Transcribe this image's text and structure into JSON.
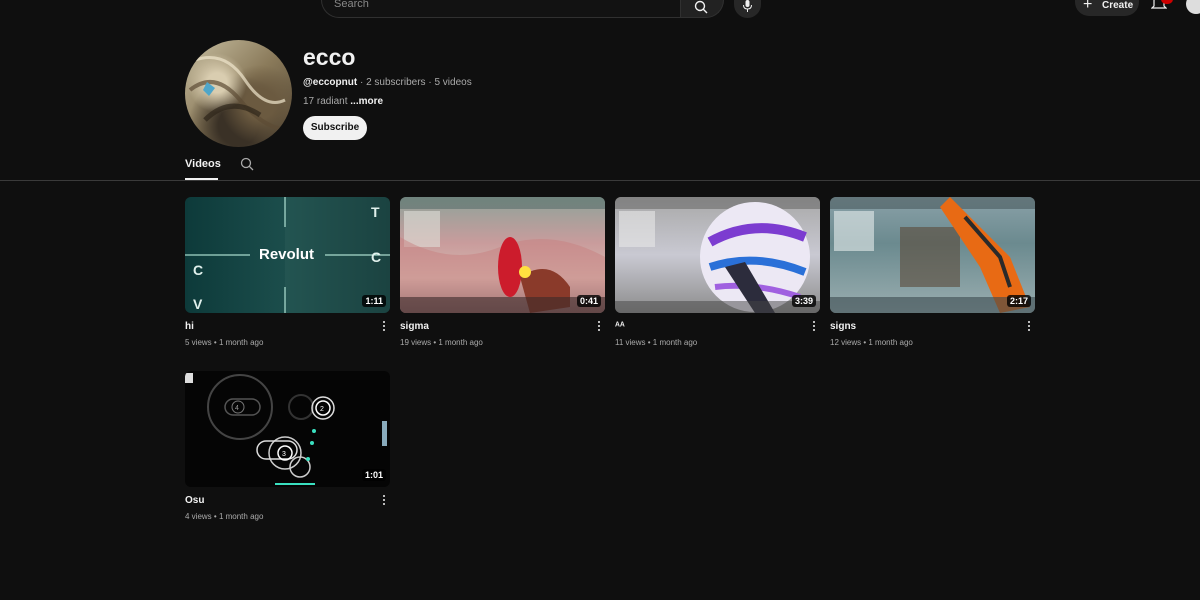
{
  "topbar": {
    "search_placeholder": "Search",
    "create_label": "Create"
  },
  "channel": {
    "name": "ecco",
    "handle": "@eccopnut",
    "meta_rest": " · 2 subscribers · 5 videos",
    "description": "17 radiant ",
    "more_label": "...more",
    "subscribe_label": "Subscribe"
  },
  "tabs": {
    "videos_label": "Videos"
  },
  "videos": [
    {
      "title": "hi",
      "views": "5 views",
      "age": "1 month ago",
      "duration": "1:11",
      "thumb_text": "Revolut"
    },
    {
      "title": "sigma",
      "views": "19 views",
      "age": "1 month ago",
      "duration": "0:41"
    },
    {
      "title": "ᴬᴬ",
      "views": "11 views",
      "age": "1 month ago",
      "duration": "3:39"
    },
    {
      "title": "signs",
      "views": "12 views",
      "age": "1 month ago",
      "duration": "2:17"
    },
    {
      "title": "Osu",
      "views": "4 views",
      "age": "1 month ago",
      "duration": "1:01"
    }
  ],
  "colors": {
    "background": "#0f0f0f",
    "text": "#f1f1f1",
    "secondary_text": "#aaaaaa",
    "notification_badge": "#cc0000"
  }
}
